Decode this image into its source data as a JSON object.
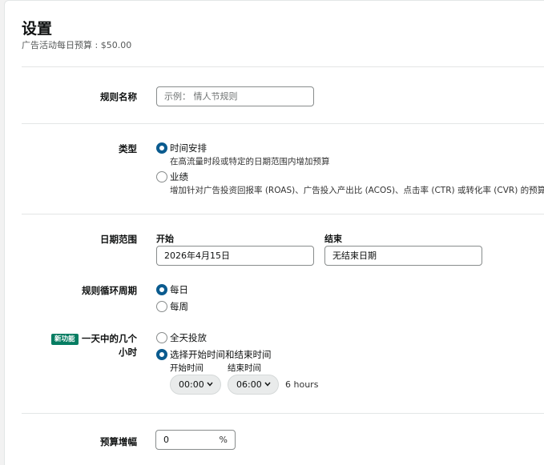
{
  "header": {
    "title": "设置",
    "subtitle": "广告活动每日预算 : $50.00"
  },
  "rule_name": {
    "label": "规则名称",
    "placeholder": "示例： 情人节规则"
  },
  "type": {
    "label": "类型",
    "options": [
      {
        "label": "时间安排",
        "desc": "在高流量时段或特定的日期范围内增加预算",
        "checked": true
      },
      {
        "label": "业绩",
        "desc": "增加针对广告投资回报率 (ROAS)、广告投入产出比 (ACOS)、点击率 (CTR) 或转化率 (CVR) 的预算",
        "checked": false
      }
    ]
  },
  "date_range": {
    "label": "日期范围",
    "start_label": "开始",
    "start_value": "2026年4月15日",
    "end_label": "结束",
    "end_value": "无结束日期"
  },
  "recurrence": {
    "label": "规则循环周期",
    "options": [
      {
        "label": "每日",
        "checked": true
      },
      {
        "label": "每周",
        "checked": false
      }
    ]
  },
  "hours_of_day": {
    "badge": "新功能",
    "label_line1": "一天中的几个",
    "label_line2": "小时",
    "options": [
      {
        "label": "全天投放",
        "checked": false
      },
      {
        "label": "选择开始时间和结束时间",
        "checked": true
      }
    ],
    "start_time_label": "开始时间",
    "end_time_label": "结束时间",
    "start_time": "00:00",
    "end_time": "06:00",
    "duration": "6 hours"
  },
  "budget_increase": {
    "label": "预算增幅",
    "value": "0",
    "unit": "%"
  },
  "colors": {
    "radio_checked": "#0a5b8f",
    "badge": "#067d62"
  },
  "icons": {
    "select_chevron": "chevron-down-icon"
  }
}
